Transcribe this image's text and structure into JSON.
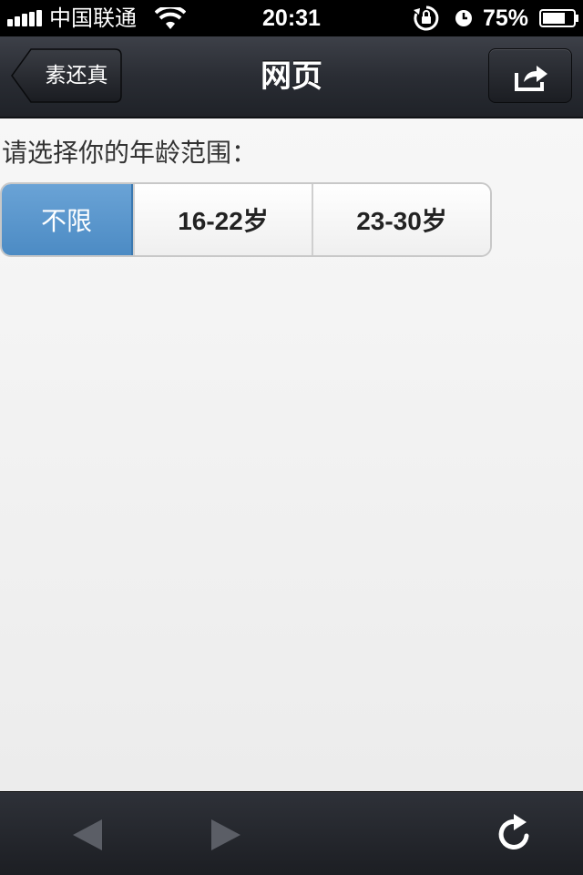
{
  "status_bar": {
    "carrier": "中国联通",
    "time": "20:31",
    "battery_percent": "75%",
    "battery_level": 0.75,
    "icons": [
      "signal-icon",
      "wifi-icon",
      "rotation-lock-icon",
      "alarm-icon",
      "battery-icon"
    ]
  },
  "nav_bar": {
    "back_label": "素还真",
    "title": "网页",
    "share_icon": "share-icon"
  },
  "content": {
    "prompt": "请选择你的年龄范围：",
    "age_options": [
      {
        "label": "不限",
        "selected": true
      },
      {
        "label": "16-22岁",
        "selected": false
      },
      {
        "label": "23-30岁",
        "selected": false
      }
    ]
  },
  "toolbar": {
    "icons": [
      "back-arrow-icon",
      "forward-arrow-icon",
      "refresh-icon"
    ]
  },
  "colors": {
    "selected_segment": "#5393cc",
    "nav_bar": "#2a2d34",
    "background": "#f4f4f4"
  }
}
